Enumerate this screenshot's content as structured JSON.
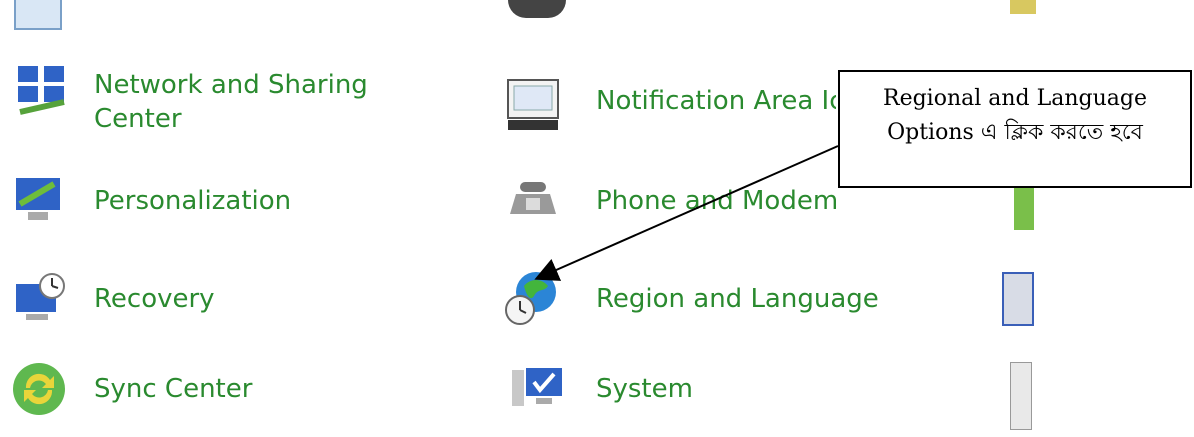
{
  "items": [
    {
      "id": "network",
      "label": "Network and Sharing Center",
      "icon": "network-icon"
    },
    {
      "id": "notification",
      "label": "Notification Area Icons",
      "icon": "notification-area-icon"
    },
    {
      "id": "personalization",
      "label": "Personalization",
      "icon": "personalization-icon"
    },
    {
      "id": "phone",
      "label": "Phone and Modem",
      "icon": "phone-icon"
    },
    {
      "id": "recovery",
      "label": "Recovery",
      "icon": "recovery-icon"
    },
    {
      "id": "region",
      "label": "Region and Language",
      "icon": "globe-clock-icon"
    },
    {
      "id": "sync",
      "label": "Sync Center",
      "icon": "sync-icon"
    },
    {
      "id": "system",
      "label": "System",
      "icon": "system-icon"
    }
  ],
  "callout": {
    "line1": "Regional and Language",
    "line2": "Options এ ক্লিক করতে হবে"
  },
  "colors": {
    "link_green": "#2a8a2f"
  }
}
